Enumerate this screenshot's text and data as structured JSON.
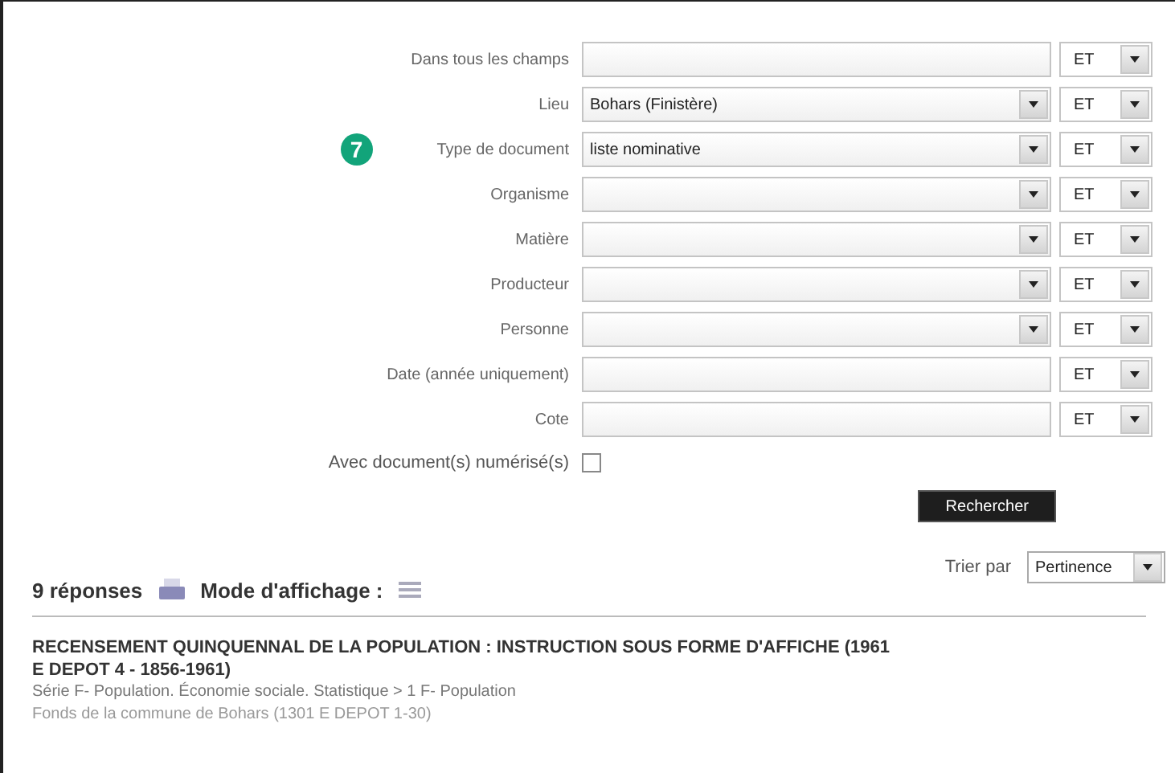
{
  "fields": [
    {
      "label": "Dans tous les champs",
      "kind": "text",
      "operator": "ET"
    },
    {
      "label": "Lieu",
      "kind": "select",
      "value": "Bohars (Finistère)",
      "operator": "ET"
    },
    {
      "label": "Type de document",
      "kind": "select",
      "value": "liste nominative",
      "operator": "ET",
      "badge": "7"
    },
    {
      "label": "Organisme",
      "kind": "select",
      "operator": "ET"
    },
    {
      "label": "Matière",
      "kind": "select",
      "operator": "ET"
    },
    {
      "label": "Producteur",
      "kind": "select",
      "operator": "ET"
    },
    {
      "label": "Personne",
      "kind": "select",
      "operator": "ET"
    },
    {
      "label": "Date (année uniquement)",
      "kind": "text",
      "operator": "ET"
    },
    {
      "label": "Cote",
      "kind": "text",
      "operator": "ET"
    }
  ],
  "digitized": {
    "label": "Avec document(s) numérisé(s)",
    "checked": false
  },
  "search_button": "Rechercher",
  "results_bar": {
    "count": "9 réponses",
    "display_mode": "Mode d'affichage :",
    "sort_label": "Trier par",
    "sort_value": "Pertinence"
  },
  "results": [
    {
      "title": "RECENSEMENT QUINQUENNAL DE LA POPULATION : INSTRUCTION SOUS FORME D'AFFICHE (1961",
      "title_cont": "E DEPOT 4 - 1856-1961)",
      "series": "Série F- Population. Économie sociale. Statistique > 1 F- Population",
      "fonds": "Fonds de la commune de Bohars (1301 E DEPOT 1-30)"
    }
  ]
}
